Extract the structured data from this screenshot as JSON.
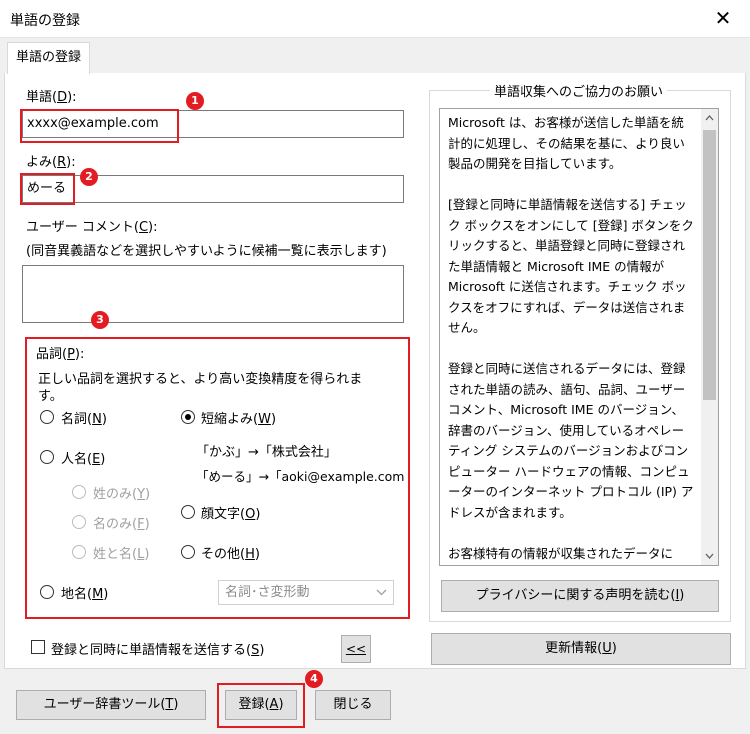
{
  "window": {
    "title": "単語の登録",
    "close_glyph": "✕"
  },
  "tab": {
    "label": "単語の登録"
  },
  "word": {
    "label": "単語(",
    "key": "D",
    "label_end": "):",
    "value": "xxxx@example.com"
  },
  "reading": {
    "label": "よみ(",
    "key": "R",
    "label_end": "):",
    "value": "めーる"
  },
  "comment": {
    "label": "ユーザー コメント(",
    "key": "C",
    "label_end": "):",
    "hint": "(同音異義語などを選択しやすいように候補一覧に表示します)",
    "value": ""
  },
  "pos": {
    "label": "品詞(",
    "key": "P",
    "label_end": "):",
    "description": "正しい品詞を選択すると、より高い変換精度を得られます。",
    "noun": {
      "label": "名詞(",
      "key": "N",
      "end": ")"
    },
    "person": {
      "label": "人名(",
      "key": "E",
      "end": ")"
    },
    "surname": {
      "label": "姓のみ(",
      "key": "Y",
      "end": ")"
    },
    "given": {
      "label": "名のみ(",
      "key": "F",
      "end": ")"
    },
    "fullname": {
      "label": "姓と名(",
      "key": "L",
      "end": ")"
    },
    "place": {
      "label": "地名(",
      "key": "M",
      "end": ")"
    },
    "abbrev": {
      "label": "短縮よみ(",
      "key": "W",
      "end": ")"
    },
    "example1": "「かぶ」→「株式会社」",
    "example2": "「めーる」→「aoki@example.com",
    "emoticon": {
      "label": "顔文字(",
      "key": "O",
      "end": ")"
    },
    "other": {
      "label": "その他(",
      "key": "H",
      "end": ")"
    },
    "dropdown_value": "名詞･さ変形動"
  },
  "send_checkbox": {
    "label": "登録と同時に単語情報を送信する(",
    "key": "S",
    "end": ")"
  },
  "collapse_button": {
    "label": "<<"
  },
  "info": {
    "title": "単語収集へのご協力のお願い",
    "text": "Microsoft は、お客様が送信した単語を統計的に処理し、その結果を基に、より良い製品の開発を目指しています。\n\n[登録と同時に単語情報を送信する] チェック ボックスをオンにして [登録] ボタンをクリックすると、単語登録と同時に登録された単語情報と Microsoft IME の情報が Microsoft に送信されます。チェック ボックスをオフにすれば、データは送信されません。\n\n登録と同時に送信されるデータには、登録された単語の読み、語句、品詞、ユーザー コメント、Microsoft IME のバージョン、辞書のバージョン、使用しているオペレーティング システムのバージョンおよびコンピューター ハードウェアの情報、コンピューターのインターネット プロトコル (IP) アドレスが含まれます。\n\nお客様特有の情報が収集されたデータに"
  },
  "privacy_button": {
    "label": "プライバシーに関する声明を読む(",
    "key": "I",
    "end": ")"
  },
  "update_button": {
    "label": "更新情報(",
    "key": "U",
    "end": ")"
  },
  "dict_tool_button": {
    "label": "ユーザー辞書ツール(",
    "key": "T",
    "end": ")"
  },
  "register_button": {
    "label": "登録(",
    "key": "A",
    "end": ")"
  },
  "close_button": {
    "label": "閉じる"
  },
  "badges": [
    "1",
    "2",
    "3",
    "4"
  ]
}
